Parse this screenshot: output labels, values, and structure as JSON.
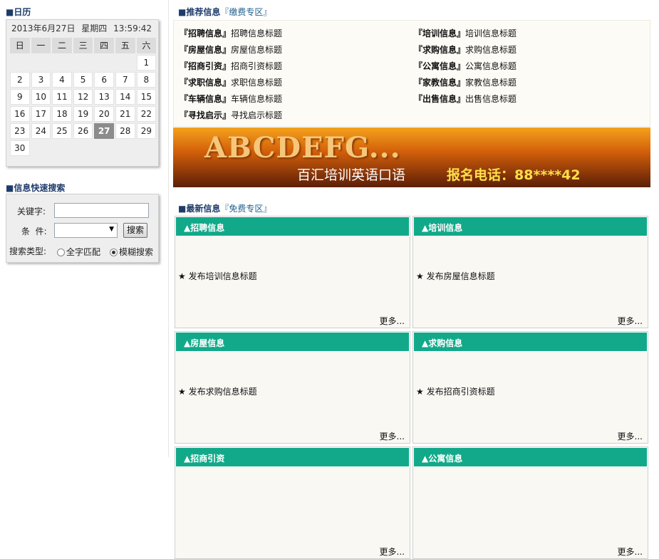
{
  "calendar": {
    "title": "■日历",
    "date_text": "2013年6月27日",
    "weekday_text": "星期四",
    "time_text": "13:59:42",
    "weekdays": [
      "日",
      "一",
      "二",
      "三",
      "四",
      "五",
      "六"
    ],
    "weeks": [
      [
        "",
        "",
        "",
        "",
        "",
        "",
        "1"
      ],
      [
        "2",
        "3",
        "4",
        "5",
        "6",
        "7",
        "8"
      ],
      [
        "9",
        "10",
        "11",
        "12",
        "13",
        "14",
        "15"
      ],
      [
        "16",
        "17",
        "18",
        "19",
        "20",
        "21",
        "22"
      ],
      [
        "23",
        "24",
        "25",
        "26",
        "27",
        "28",
        "29"
      ],
      [
        "30",
        "",
        "",
        "",
        "",
        "",
        ""
      ]
    ],
    "today": "27"
  },
  "search": {
    "title": "■信息快速搜索",
    "keyword_label": "关键字:",
    "keyword_value": "",
    "condition_label": "条  件:",
    "condition_value": "",
    "search_button": "搜索",
    "type_label": "搜索类型:",
    "option_exact": "全字匹配",
    "option_fuzzy": "模糊搜索",
    "selected_option": "模糊搜索"
  },
  "recommend": {
    "title": "■推荐信息",
    "subtitle": "『缴费专区』",
    "items": [
      {
        "cat": "『招聘信息』",
        "text": "招聘信息标题"
      },
      {
        "cat": "『培训信息』",
        "text": "培训信息标题"
      },
      {
        "cat": "『房屋信息』",
        "text": "房屋信息标题"
      },
      {
        "cat": "『求购信息』",
        "text": "求购信息标题"
      },
      {
        "cat": "『招商引资』",
        "text": "招商引资标题"
      },
      {
        "cat": "『公寓信息』",
        "text": "公寓信息标题"
      },
      {
        "cat": "『求职信息』",
        "text": "求职信息标题"
      },
      {
        "cat": "『家教信息』",
        "text": "家教信息标题"
      },
      {
        "cat": "『车辆信息』",
        "text": "车辆信息标题"
      },
      {
        "cat": "『出售信息』",
        "text": "出售信息标题"
      },
      {
        "cat": "『寻找启示』",
        "text": "寻找启示标题"
      }
    ]
  },
  "banner": {
    "big_text": "ABCDEFG...",
    "line1": "百汇培训英语口语",
    "line2": "报名电话：88****42"
  },
  "latest": {
    "title": "■最新信息",
    "subtitle": "『免费专区』",
    "more": "更多...",
    "cards": [
      {
        "head": "▲招聘信息",
        "body": "★ 发布培训信息标题"
      },
      {
        "head": "▲培训信息",
        "body": "★ 发布房屋信息标题"
      },
      {
        "head": "▲房屋信息",
        "body": "★ 发布求购信息标题"
      },
      {
        "head": "▲求购信息",
        "body": "★ 发布招商引资标题"
      },
      {
        "head": "▲招商引资",
        "body": ""
      },
      {
        "head": "▲公寓信息",
        "body": ""
      }
    ]
  }
}
